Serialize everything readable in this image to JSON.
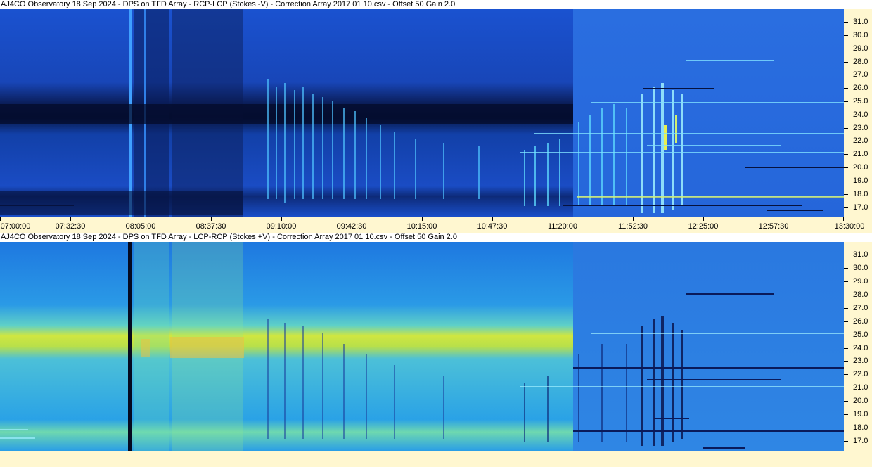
{
  "top_panel": {
    "title": "AJ4CO Observatory 18 Sep 2024  -  DPS on TFD Array  -  RCP-LCP (Stokes -V)  -  Correction Array 2017 01 10.csv  -  Offset 50  Gain 2.0"
  },
  "bottom_panel": {
    "title": "AJ4CO Observatory 18 Sep 2024  -  DPS on TFD Array  -  LCP-RCP (Stokes +V)  -  Correction Array 2017 01 10.csv  -  Offset 50  Gain 2.0"
  },
  "freq_labels": [
    "31.0",
    "30.0",
    "29.0",
    "28.0",
    "27.0",
    "26.0",
    "25.0",
    "24.0",
    "23.0",
    "22.0",
    "21.0",
    "20.0",
    "19.0",
    "18.0",
    "17.0"
  ],
  "time_labels": [
    "07:00:00",
    "07:32:30",
    "08:05:00",
    "08:37:30",
    "09:10:00",
    "09:42:30",
    "10:15:00",
    "10:47:30",
    "11:20:00",
    "11:52:30",
    "12:25:00",
    "12:57:30",
    "13:30:00"
  ],
  "colors": {
    "top_background": "#1f5fd6",
    "bottom_background": "#2a9be8",
    "axis_background": "#fff7d0",
    "band_dark": "#0a1a4a",
    "band_yellow": "#d8e83a"
  }
}
